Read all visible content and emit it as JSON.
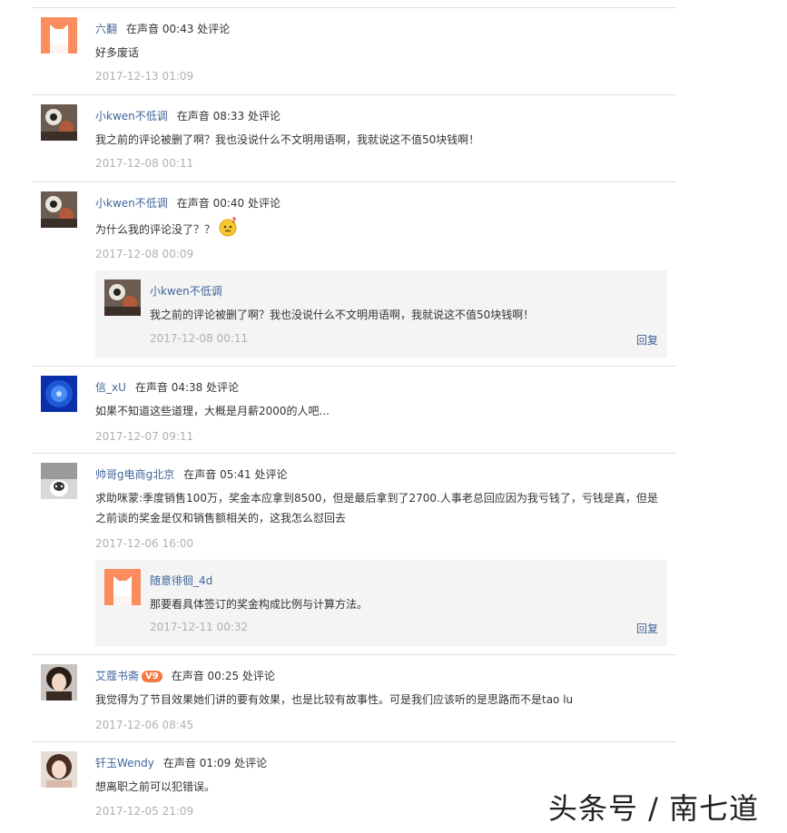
{
  "comments": [
    {
      "user": "六翻",
      "meta": "在声音 00:43 处评论",
      "text": "好多废话",
      "time": "2017-12-13 01:09"
    },
    {
      "user": "小kwen不低调",
      "meta": "在声音 08:33 处评论",
      "text": "我之前的评论被删了啊？我也没说什么不文明用语啊，我就说这不值50块钱啊！",
      "time": "2017-12-08 00:11"
    },
    {
      "user": "小kwen不低调",
      "meta": "在声音 00:40 处评论",
      "text": "为什么我的评论没了？？",
      "time": "2017-12-08 00:09",
      "reply": {
        "user": "小kwen不低调",
        "text": "我之前的评论被删了啊？我也没说什么不文明用语啊，我就说这不值50块钱啊！",
        "time": "2017-12-08 00:11",
        "reply_label": "回复"
      }
    },
    {
      "user": "信_xU",
      "meta": "在声音 04:38 处评论",
      "text": "如果不知道这些道理，大概是月薪2000的人吧...",
      "time": "2017-12-07 09:11"
    },
    {
      "user": "帅哥g电商g北京",
      "meta": "在声音 05:41 处评论",
      "text": "求助咪蒙:季度销售100万，奖金本应拿到8500，但是最后拿到了2700.人事老总回应因为我亏钱了，亏钱是真，但是之前谈的奖金是仅和销售额相关的，这我怎么怼回去",
      "time": "2017-12-06 16:00",
      "reply": {
        "user": "随意徘徊_4d",
        "text": "那要看具体签订的奖金构成比例与计算方法。",
        "time": "2017-12-11 00:32",
        "reply_label": "回复"
      }
    },
    {
      "user": "艾蔻书斋",
      "badge": "V9",
      "meta": "在声音 00:25 处评论",
      "text": "我觉得为了节目效果她们讲的要有效果，也是比较有故事性。可是我们应该听的是思路而不是tao lu",
      "time": "2017-12-06 08:45"
    },
    {
      "user": "钎玉Wendy",
      "meta": "在声音 01:09 处评论",
      "text": "想离职之前可以犯错误。",
      "time": "2017-12-05 21:09"
    }
  ],
  "watermark": "头条号 / 南七道",
  "colors": {
    "username": "#406599",
    "timestamp": "#b0b0b0",
    "badge": "#f47c44",
    "reply_bg": "#f4f4f4",
    "divider": "#dedede"
  },
  "icons": [
    "default-cat-avatar-icon",
    "thinking-emoji-icon"
  ]
}
